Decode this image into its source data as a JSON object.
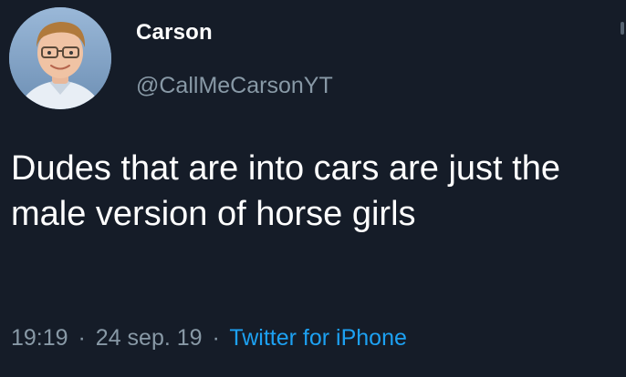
{
  "tweet": {
    "author": {
      "display_name": "Carson",
      "handle": "@CallMeCarsonYT",
      "avatar_icon": "profile-photo"
    },
    "text": "Dudes that are into cars are just the male version of horse girls",
    "time": "19:19",
    "date": "24 sep. 19",
    "separator": "·",
    "source": "Twitter for iPhone"
  },
  "colors": {
    "background": "#151c28",
    "text_primary": "#ffffff",
    "text_secondary": "#8899a6",
    "link": "#1da1f2"
  }
}
